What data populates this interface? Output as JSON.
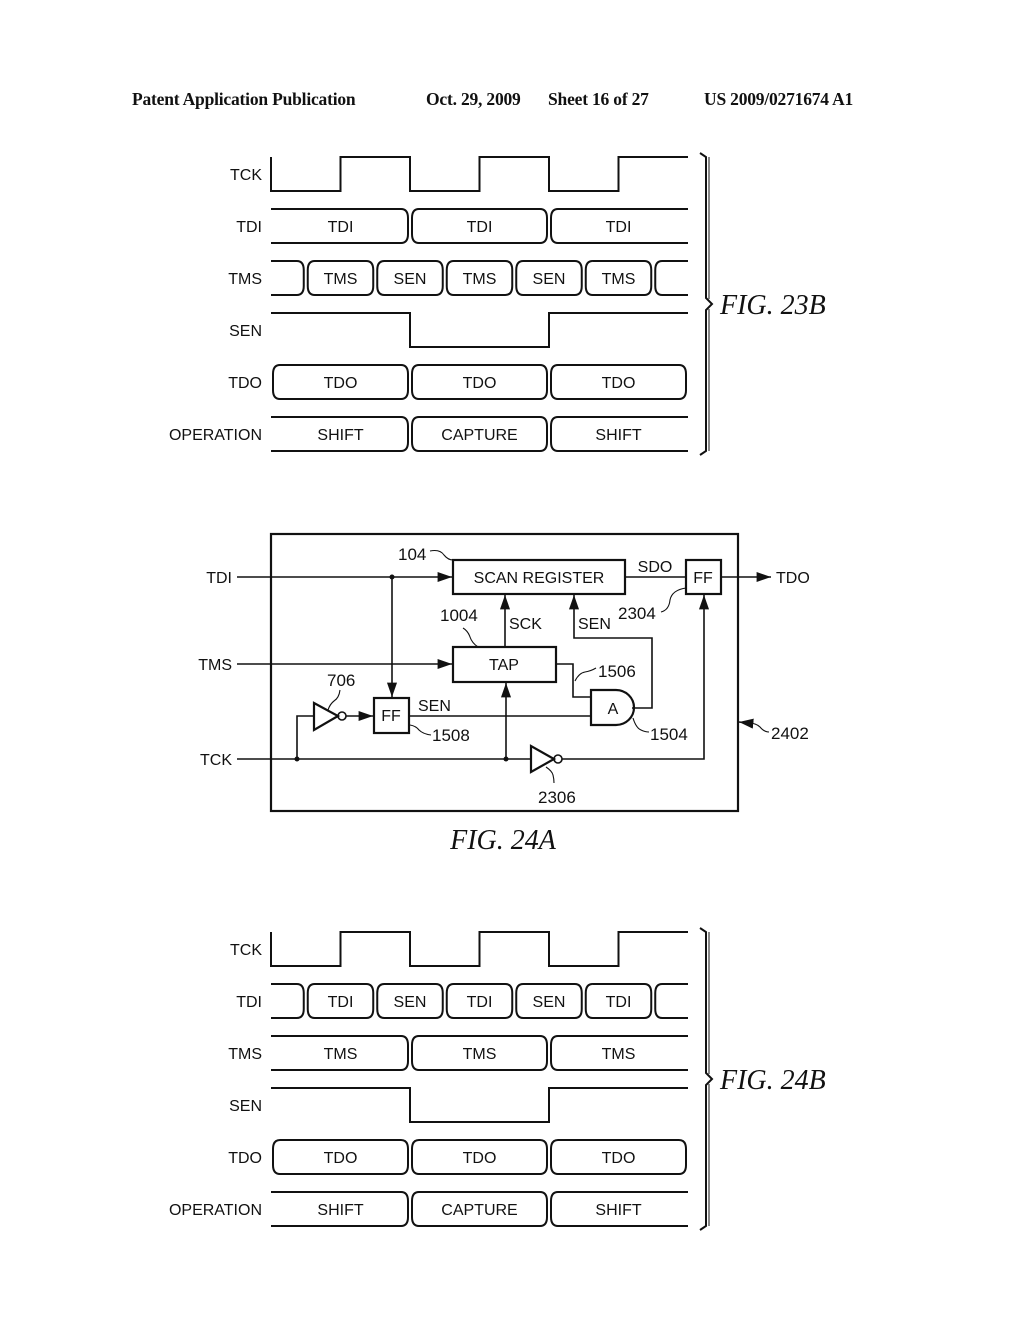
{
  "header": {
    "publication": "Patent Application Publication",
    "date": "Oct. 29, 2009",
    "sheet": "Sheet 16 of 27",
    "number": "US 2009/0271674 A1"
  },
  "fig23b": {
    "caption": "FIG. 23B",
    "signals": [
      {
        "name": "TCK",
        "type": "clock",
        "label": "TCK"
      },
      {
        "name": "TDI",
        "type": "bus",
        "label": "TDI",
        "cells": [
          "TDI",
          "TDI",
          "TDI"
        ]
      },
      {
        "name": "TMS",
        "type": "halfbus",
        "label": "TMS",
        "cells": [
          "TMS",
          "SEN",
          "TMS",
          "SEN",
          "TMS"
        ]
      },
      {
        "name": "SEN",
        "type": "level",
        "label": "SEN",
        "levels": [
          1,
          0,
          1
        ]
      },
      {
        "name": "TDO",
        "type": "boxbus",
        "label": "TDO",
        "cells": [
          "TDO",
          "TDO",
          "TDO"
        ]
      },
      {
        "name": "OPERATION",
        "type": "bus",
        "label": "OPERATION",
        "cells": [
          "SHIFT",
          "CAPTURE",
          "SHIFT"
        ]
      }
    ]
  },
  "fig24a": {
    "caption": "FIG. 24A",
    "inputs": {
      "tdi": "TDI",
      "tms": "TMS",
      "tck": "TCK"
    },
    "output": "TDO",
    "blocks": {
      "scan_register": "SCAN REGISTER",
      "tap": "TAP",
      "ff_out": "FF",
      "ff_sen": "FF",
      "and_gate": "A"
    },
    "nets": {
      "sdo": "SDO",
      "sck": "SCK",
      "sen_top": "SEN",
      "sen_mid": "SEN"
    },
    "refs": {
      "scan_register": "104",
      "tap": "1004",
      "ff_out": "2304",
      "inv_706": "706",
      "ff_sen": "1508",
      "net_1506": "1506",
      "and_gate": "1504",
      "inv_2306": "2306",
      "module": "2402"
    }
  },
  "fig24b": {
    "caption": "FIG. 24B",
    "signals": [
      {
        "name": "TCK",
        "type": "clock",
        "label": "TCK"
      },
      {
        "name": "TDI",
        "type": "halfbus",
        "label": "TDI",
        "cells": [
          "TDI",
          "SEN",
          "TDI",
          "SEN",
          "TDI"
        ]
      },
      {
        "name": "TMS",
        "type": "bus",
        "label": "TMS",
        "cells": [
          "TMS",
          "TMS",
          "TMS"
        ]
      },
      {
        "name": "SEN",
        "type": "level",
        "label": "SEN",
        "levels": [
          1,
          0,
          1
        ]
      },
      {
        "name": "TDO",
        "type": "boxbus",
        "label": "TDO",
        "cells": [
          "TDO",
          "TDO",
          "TDO"
        ]
      },
      {
        "name": "OPERATION",
        "type": "bus",
        "label": "OPERATION",
        "cells": [
          "SHIFT",
          "CAPTURE",
          "SHIFT"
        ]
      }
    ]
  }
}
